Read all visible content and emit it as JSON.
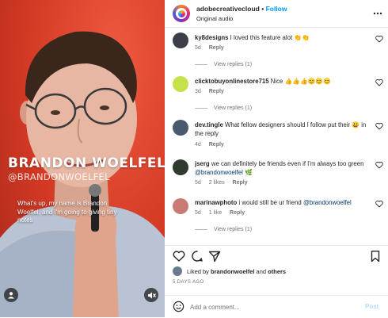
{
  "video": {
    "overlay_name": "BRANDON WOELFEL",
    "overlay_handle": "@BRANDONWOELFEL",
    "caption": "What's up, my name is Brandon Woelfel, and I'm going to giving tiny notes",
    "user_icon": "user-icon",
    "mute_icon": "muted-speaker-icon"
  },
  "header": {
    "username": "adobecreativecloud",
    "dot": "•",
    "follow": "Follow",
    "audio": "Original audio",
    "more_icon": "more-horizontal-icon"
  },
  "comments": [
    {
      "user": "ky8designs",
      "text": "I loved this feature alot 👏👏",
      "time": "5d",
      "likes": "",
      "reply": "Reply",
      "view_replies": "View replies (1)",
      "avatar_color": "#3a3f4a"
    },
    {
      "user": "clicktobuyonlinestore715",
      "text": "Nice 👍👍👍😊😊😊",
      "time": "3d",
      "likes": "",
      "reply": "Reply",
      "view_replies": "View replies (1)",
      "avatar_color": "#c6e24a"
    },
    {
      "user": "dev.tingle",
      "text": "What fellow designers should I follow put their 😃 in the reply",
      "time": "4d",
      "likes": "",
      "reply": "Reply",
      "view_replies": "",
      "avatar_color": "#4a5a6e"
    },
    {
      "user": "jserg",
      "text": "we can definitely be friends even if I'm always too green",
      "mention": "@brandonwoelfel",
      "emoji": "🌿",
      "time": "5d",
      "likes": "2 likes",
      "reply": "Reply",
      "view_replies": "",
      "avatar_color": "#2f3b2c"
    },
    {
      "user": "marinawphoto",
      "text": "i would still be ur friend",
      "mention": "@brandonwoelfel",
      "time": "5d",
      "likes": "1 like",
      "reply": "Reply",
      "view_replies": "View replies (1)",
      "avatar_color": "#c97b73"
    }
  ],
  "actions": {
    "like_icon": "heart-icon",
    "comment_icon": "comment-icon",
    "share_icon": "share-icon",
    "save_icon": "bookmark-icon"
  },
  "likes": {
    "prefix": "Liked by",
    "user": "brandonwoelfel",
    "middle": "and",
    "others": "others"
  },
  "posted": "5 DAYS AGO",
  "add_comment": {
    "placeholder": "Add a comment...",
    "post": "Post",
    "emoji_icon": "smile-icon"
  },
  "colors": {
    "accent": "#0095f6",
    "video_bg": "#d83a26",
    "post_disabled": "#b3dbff"
  }
}
